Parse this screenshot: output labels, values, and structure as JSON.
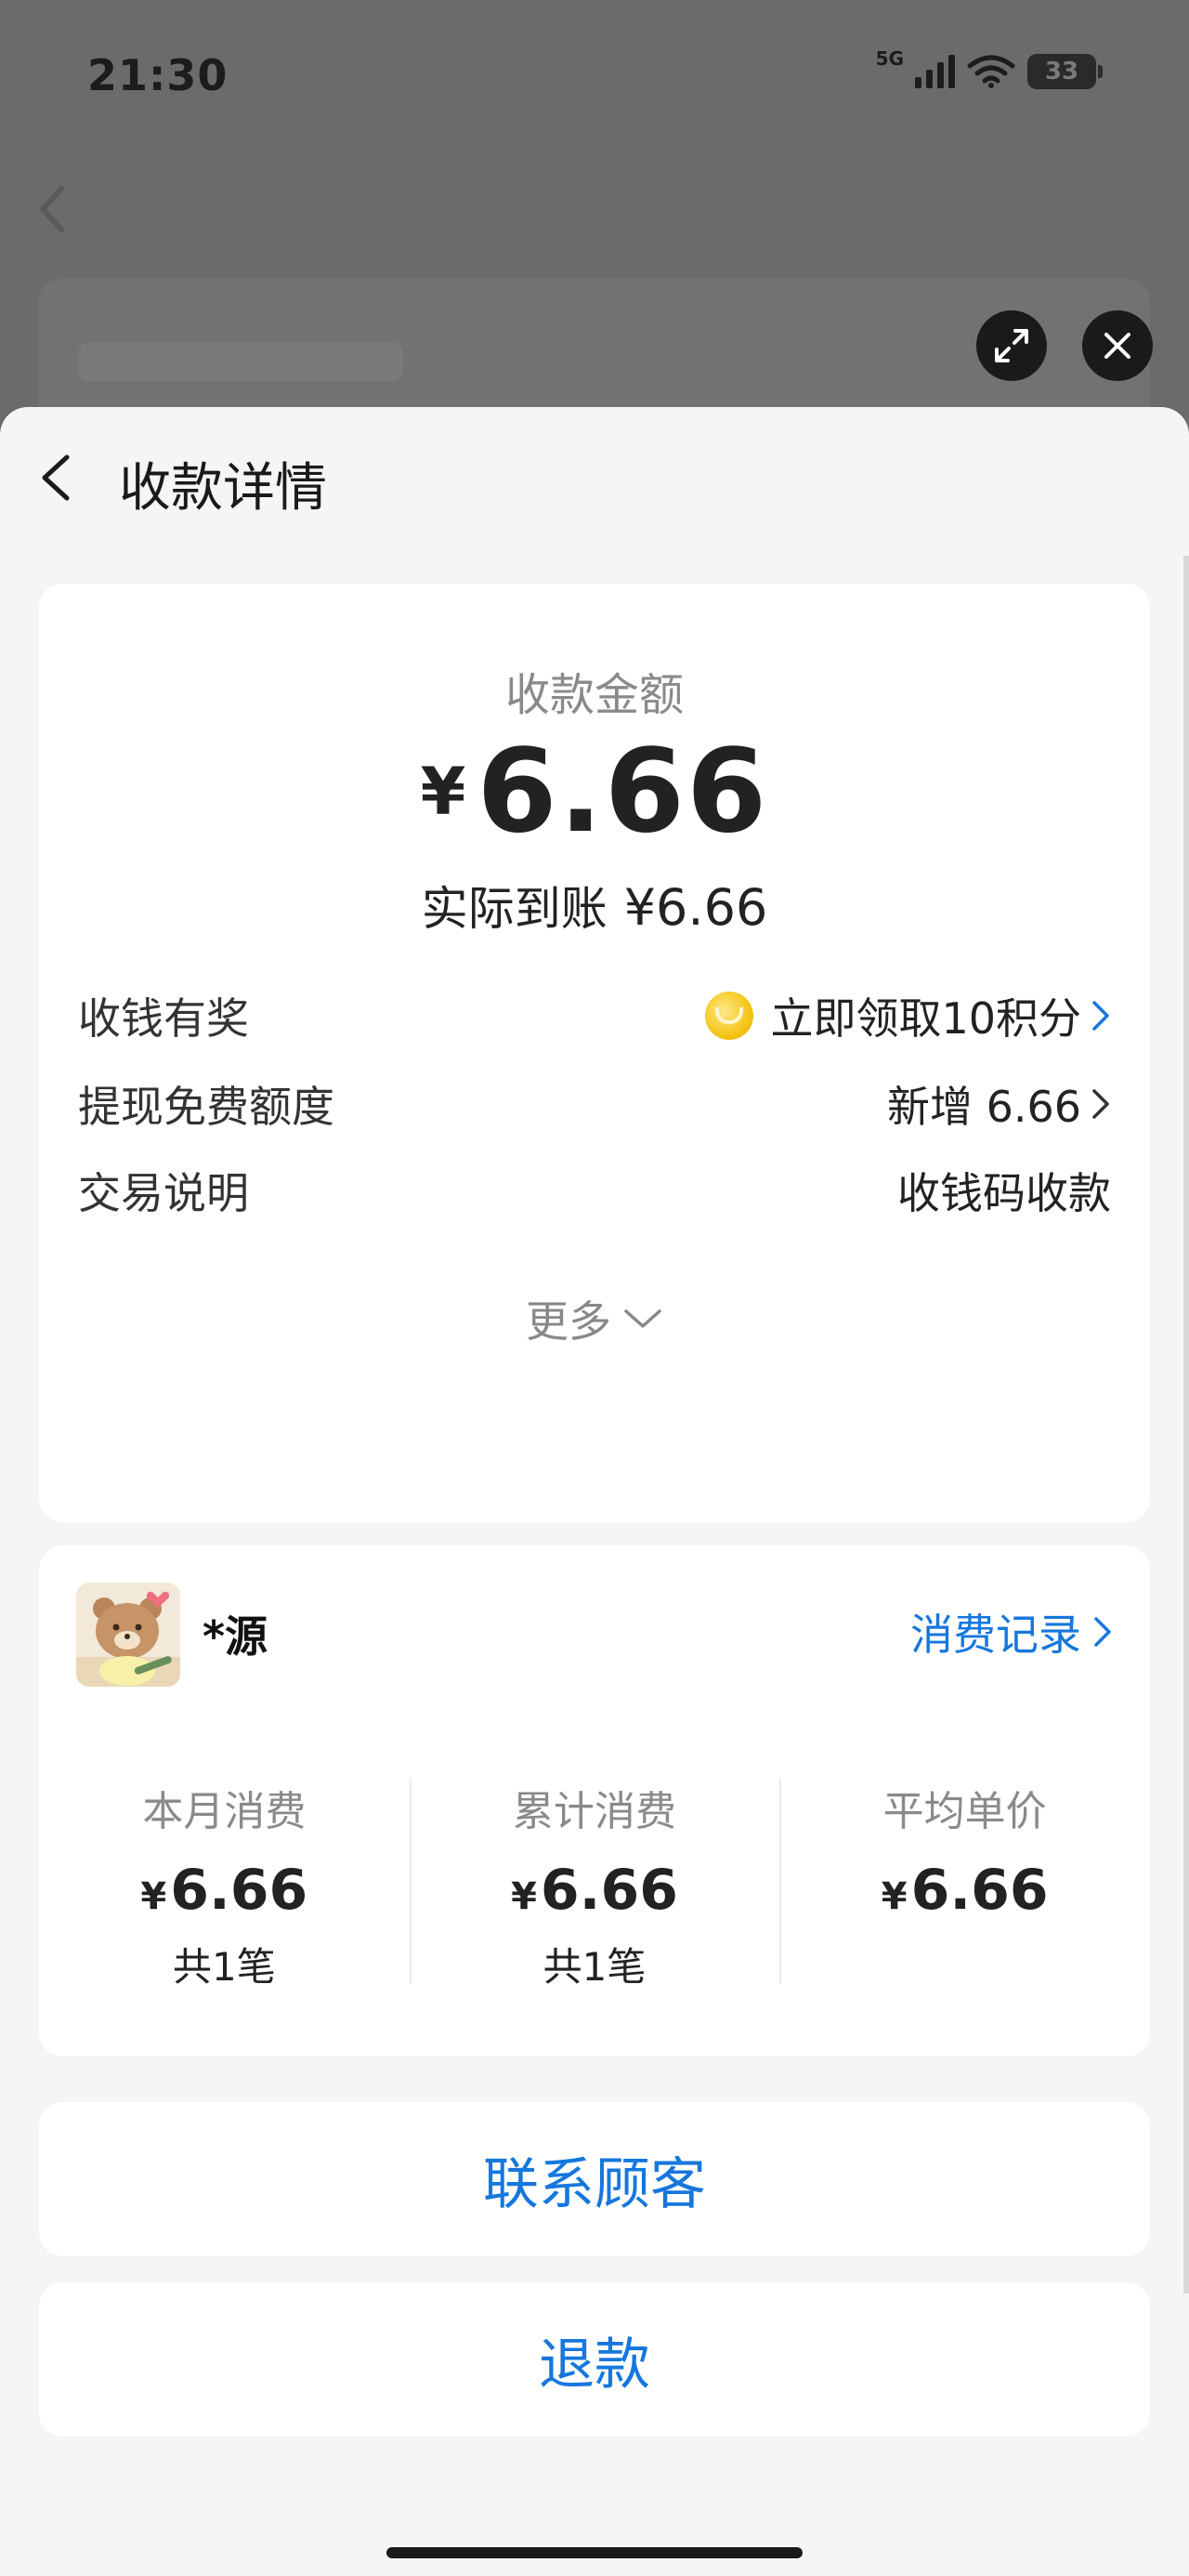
{
  "status_bar": {
    "time": "21:30",
    "network": "5G",
    "battery": "33"
  },
  "header": {
    "title": "收款详情"
  },
  "amount_card": {
    "label": "收款金额",
    "currency": "¥",
    "amount": "6.66",
    "actual_label": "实际到账",
    "actual_amount": "¥6.66",
    "rows": [
      {
        "label": "收钱有奖",
        "value": "立即领取10积分"
      },
      {
        "label": "提现免费额度",
        "value": "新增 6.66"
      },
      {
        "label": "交易说明",
        "value": "收钱码收款"
      }
    ],
    "more_label": "更多"
  },
  "customer_card": {
    "name": "*源",
    "records_label": "消费记录",
    "stats": [
      {
        "label": "本月消费",
        "currency": "¥",
        "value": "6.66",
        "count": "共1笔"
      },
      {
        "label": "累计消费",
        "currency": "¥",
        "value": "6.66",
        "count": "共1笔"
      },
      {
        "label": "平均单价",
        "currency": "¥",
        "value": "6.66",
        "count": ""
      }
    ]
  },
  "actions": {
    "contact": "联系顾客",
    "refund": "退款"
  },
  "colors": {
    "accent": "#1677dd",
    "background": "#f5f5f5",
    "overlay": "#6b6b6b"
  }
}
